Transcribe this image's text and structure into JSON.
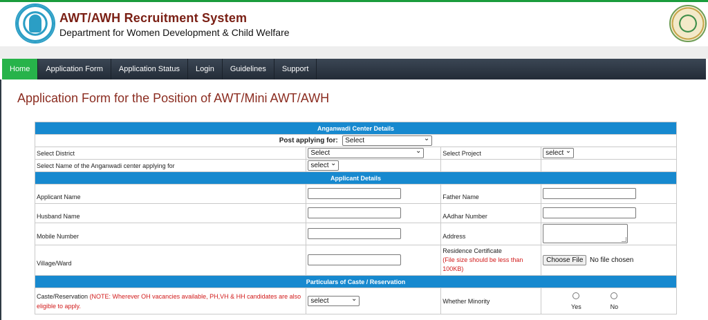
{
  "header": {
    "title": "AWT/AWH Recruitment System",
    "subtitle": "Department for Women Development & Child Welfare"
  },
  "nav": {
    "items": [
      {
        "label": "Home"
      },
      {
        "label": "Application Form"
      },
      {
        "label": "Application Status"
      },
      {
        "label": "Login"
      },
      {
        "label": "Guidelines"
      },
      {
        "label": "Support"
      }
    ]
  },
  "page": {
    "heading": "Application Form for the Position of AWT/Mini AWT/AWH"
  },
  "form": {
    "sections": {
      "anganwadi": "Anganwadi Center Details",
      "applicant": "Applicant Details",
      "caste": "Particulars of Caste / Reservation"
    },
    "post_label": "Post applying for:",
    "post_value": "Select",
    "district_label": "Select District",
    "district_value": "Select",
    "project_label": "Select Project",
    "project_value": "select",
    "center_label": "Select Name of the Anganwadi center applying for",
    "center_value": "select",
    "applicant_name": "Applicant Name",
    "father_name": "Father Name",
    "husband_name": "Husband Name",
    "aadhar_number": "AAdhar Number",
    "mobile_number": "Mobile Number",
    "address": "Address",
    "village": "Village/Ward",
    "residence_label": "Residence Certificate",
    "residence_note": "(File size should be less than 100KB)",
    "choose_file": "Choose File",
    "no_file": "No file chosen",
    "caste_label": "Caste/Reservation",
    "caste_note": "(NOTE: Wherever OH vacancies available, PH,VH & HH candidates are also eligible to apply.",
    "caste_value": "select",
    "minority_label": "Whether Minority",
    "minority_yes": "Yes",
    "minority_no": "No"
  }
}
